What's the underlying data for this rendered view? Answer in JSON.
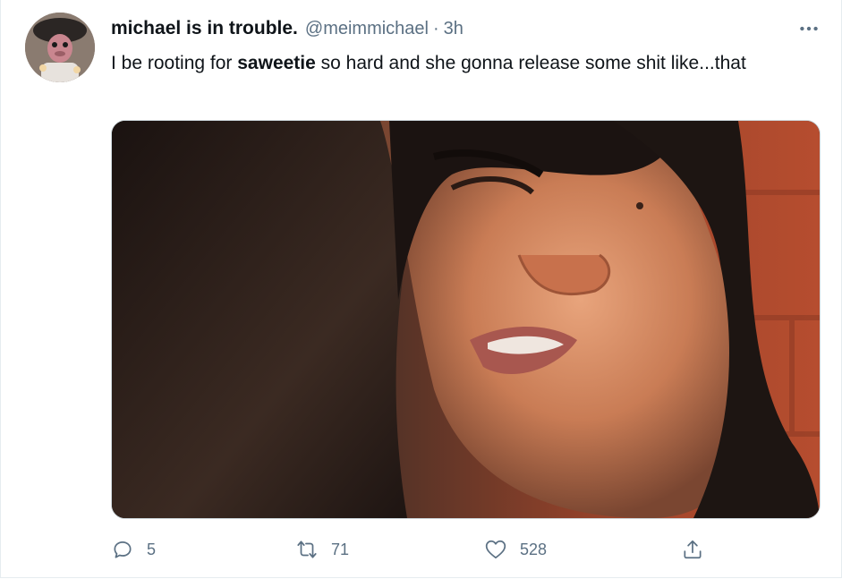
{
  "tweet": {
    "author": {
      "display_name": "michael is in trouble.",
      "handle": "@meimmichael",
      "separator": "·",
      "time": "3h",
      "avatar_icon": "profile-avatar"
    },
    "text": {
      "before_bold": "I be rooting for ",
      "bold": "saweetie",
      "after_bold": " so hard and she gonna release some shit like...that"
    },
    "media": {
      "type": "image",
      "description_icon": "photo"
    },
    "actions": {
      "reply_count": "5",
      "retweet_count": "71",
      "like_count": "528",
      "share_icon": "share-icon"
    },
    "colors": {
      "text_primary": "#0f1419",
      "text_secondary": "#5b7083",
      "border": "#e6ecf0"
    }
  }
}
